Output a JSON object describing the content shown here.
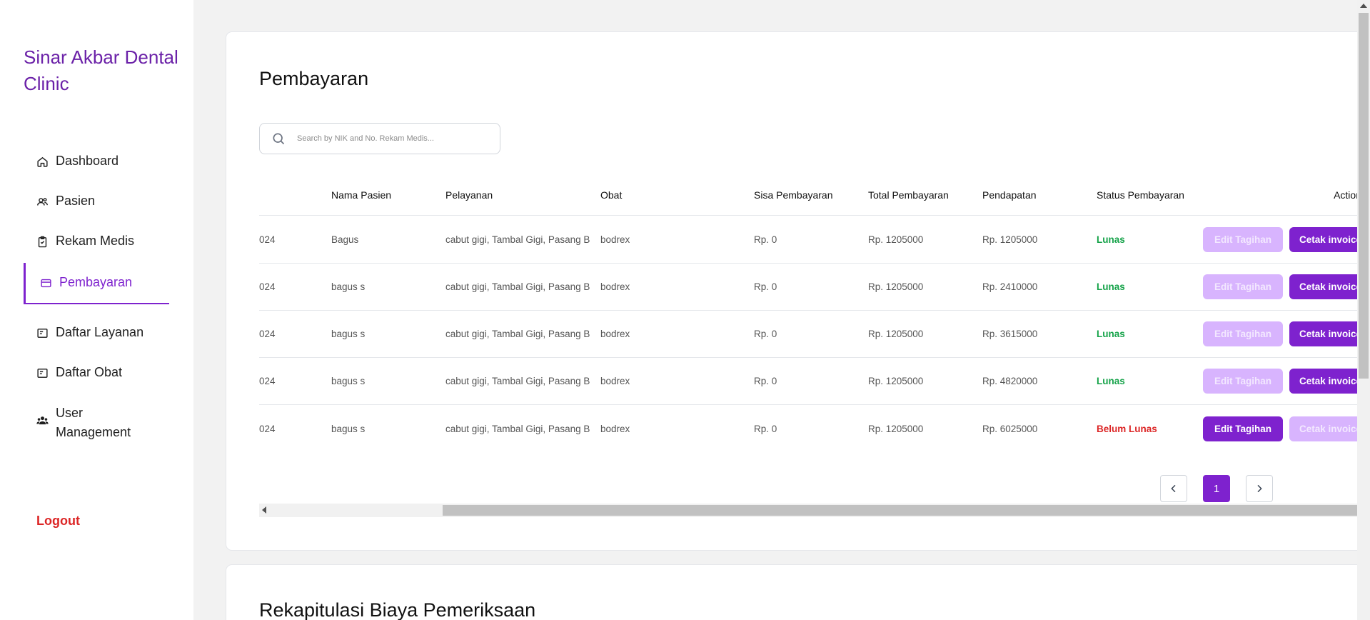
{
  "sidebar": {
    "brand": "Sinar Akbar Dental Clinic",
    "items": [
      {
        "label": "Dashboard",
        "icon": "home-icon"
      },
      {
        "label": "Pasien",
        "icon": "users-icon"
      },
      {
        "label": "Rekam Medis",
        "icon": "clipboard-icon"
      },
      {
        "label": "Pembayaran",
        "icon": "credit-card-icon",
        "active": true
      },
      {
        "label": "Daftar Layanan",
        "icon": "list-card-icon"
      },
      {
        "label": "Daftar Obat",
        "icon": "list-card-icon"
      },
      {
        "label": "User Management",
        "icon": "user-group-icon"
      }
    ],
    "logout": "Logout"
  },
  "main": {
    "title": "Pembayaran",
    "search": {
      "placeholder": "Search by NIK and No. Rekam Medis..."
    },
    "table": {
      "headers": [
        "Nama Pasien",
        "Pelayanan",
        "Obat",
        "Sisa Pembayaran",
        "Total Pembayaran",
        "Pendapatan",
        "Status Pembayaran",
        "Action"
      ],
      "rows": [
        {
          "date_fragment": "024",
          "nama": "Bagus",
          "pelayanan": "cabut gigi, Tambal Gigi, Pasang B",
          "obat": "bodrex",
          "sisa": "Rp. 0",
          "total": "Rp. 1205000",
          "pendapatan": "Rp. 1205000",
          "status": "Lunas"
        },
        {
          "date_fragment": "024",
          "nama": "bagus s",
          "pelayanan": "cabut gigi, Tambal Gigi, Pasang B",
          "obat": "bodrex",
          "sisa": "Rp. 0",
          "total": "Rp. 1205000",
          "pendapatan": "Rp. 2410000",
          "status": "Lunas"
        },
        {
          "date_fragment": "024",
          "nama": "bagus s",
          "pelayanan": "cabut gigi, Tambal Gigi, Pasang B",
          "obat": "bodrex",
          "sisa": "Rp. 0",
          "total": "Rp. 1205000",
          "pendapatan": "Rp. 3615000",
          "status": "Lunas"
        },
        {
          "date_fragment": "024",
          "nama": "bagus s",
          "pelayanan": "cabut gigi, Tambal Gigi, Pasang B",
          "obat": "bodrex",
          "sisa": "Rp. 0",
          "total": "Rp. 1205000",
          "pendapatan": "Rp. 4820000",
          "status": "Lunas"
        },
        {
          "date_fragment": "024",
          "nama": "bagus s",
          "pelayanan": "cabut gigi, Tambal Gigi, Pasang B",
          "obat": "bodrex",
          "sisa": "Rp. 0",
          "total": "Rp. 1205000",
          "pendapatan": "Rp. 6025000",
          "status": "Belum Lunas"
        }
      ],
      "actions": {
        "edit": "Edit Tagihan",
        "print": "Cetak invoice"
      }
    },
    "pagination": {
      "current": "1"
    }
  },
  "section2": {
    "title": "Rekapitulasi Biaya Pemeriksaan"
  },
  "colors": {
    "accent": "#7e22ce",
    "success": "#16a34a",
    "danger": "#dc2626",
    "muted_button": "#d8b4fe"
  }
}
